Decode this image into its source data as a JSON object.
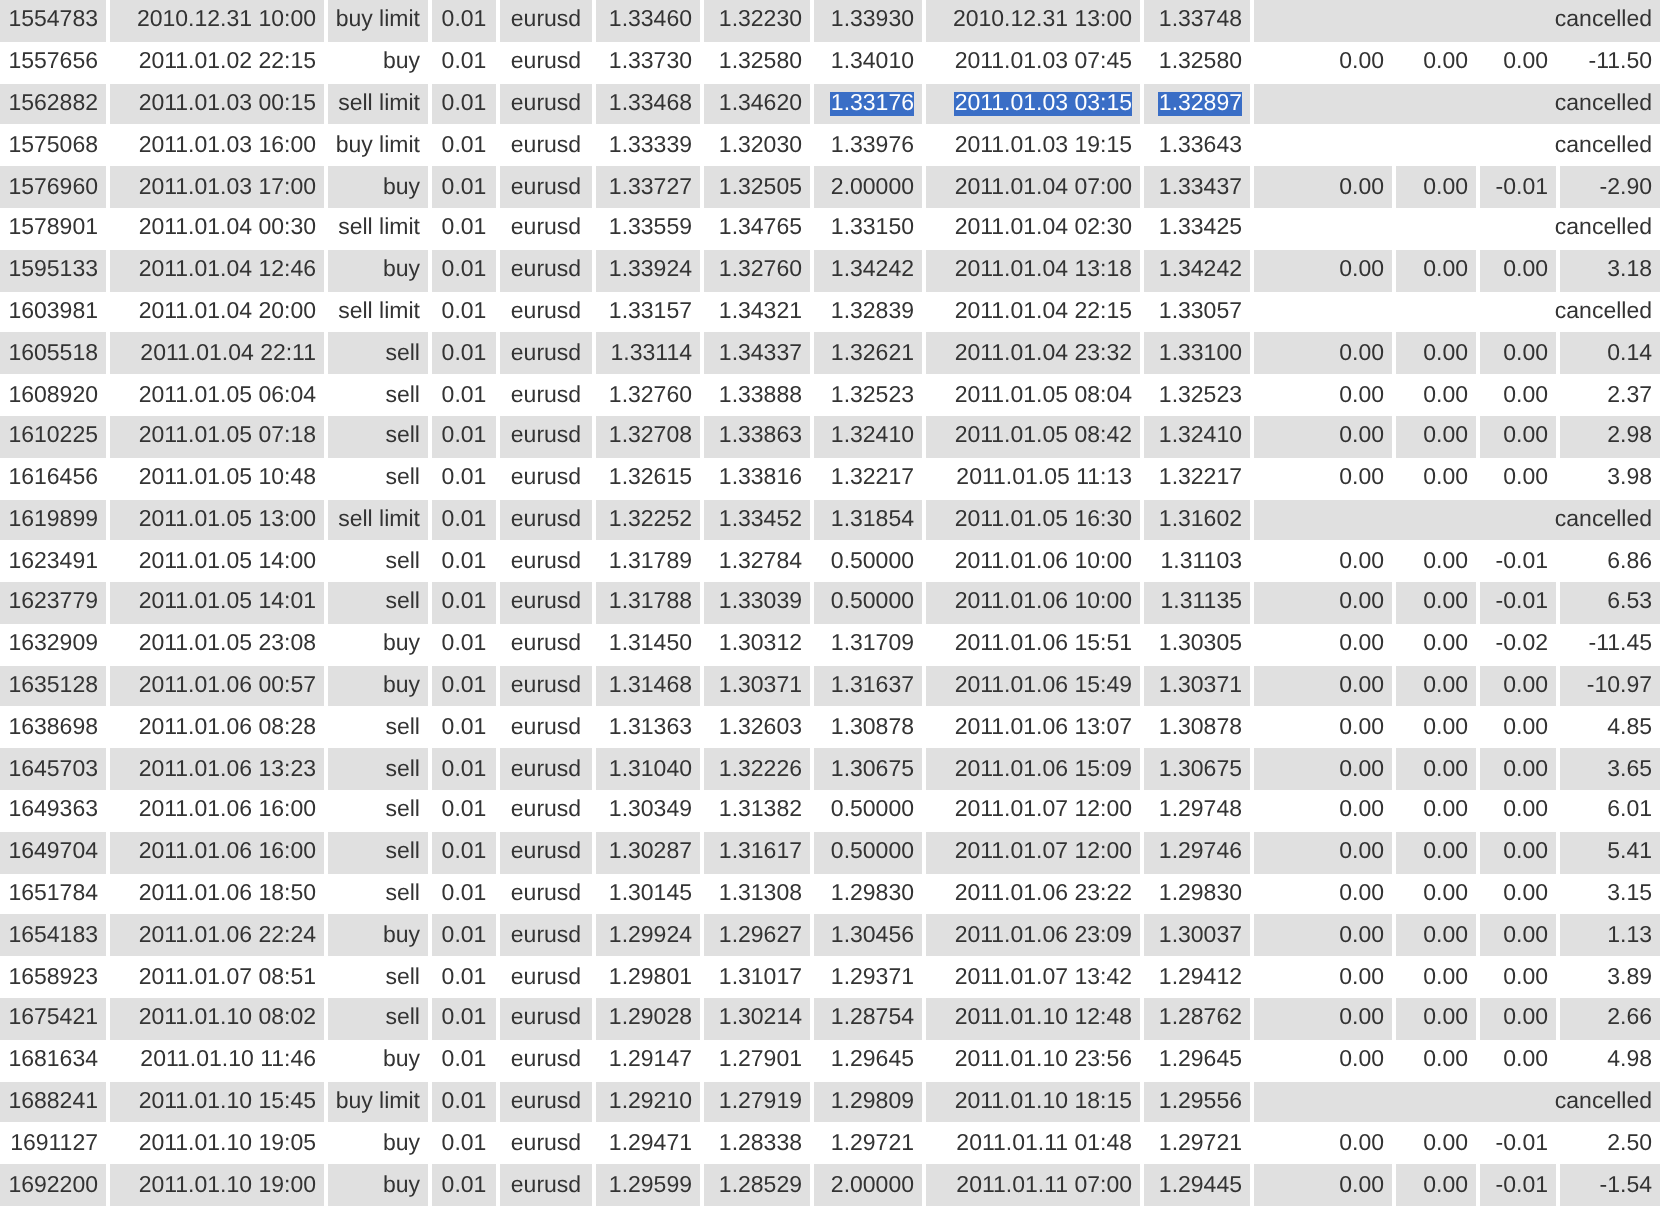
{
  "rows": [
    {
      "kind": "cancelled",
      "selected": false,
      "ticket": "1554783",
      "open_time": "2010.12.31 10:00",
      "type": "buy limit",
      "size": "0.01",
      "symbol": "eurusd",
      "open_price": "1.33460",
      "sl": "1.32230",
      "tp": "1.33930",
      "close_time": "2010.12.31 13:00",
      "close_price": "1.33748",
      "status": "cancelled"
    },
    {
      "kind": "closed",
      "selected": false,
      "ticket": "1557656",
      "open_time": "2011.01.02 22:15",
      "type": "buy",
      "size": "0.01",
      "symbol": "eurusd",
      "open_price": "1.33730",
      "sl": "1.32580",
      "tp": "1.34010",
      "close_time": "2011.01.03 07:45",
      "close_price": "1.32580",
      "commission": "0.00",
      "taxes": "0.00",
      "swap": "0.00",
      "profit": "-11.50"
    },
    {
      "kind": "cancelled",
      "selected": true,
      "ticket": "1562882",
      "open_time": "2011.01.03 00:15",
      "type": "sell limit",
      "size": "0.01",
      "symbol": "eurusd",
      "open_price": "1.33468",
      "sl": "1.34620",
      "tp": "1.33176",
      "close_time": "2011.01.03 03:15",
      "close_price": "1.32897",
      "status": "cancelled"
    },
    {
      "kind": "cancelled",
      "selected": false,
      "ticket": "1575068",
      "open_time": "2011.01.03 16:00",
      "type": "buy limit",
      "size": "0.01",
      "symbol": "eurusd",
      "open_price": "1.33339",
      "sl": "1.32030",
      "tp": "1.33976",
      "close_time": "2011.01.03 19:15",
      "close_price": "1.33643",
      "status": "cancelled"
    },
    {
      "kind": "closed",
      "selected": false,
      "ticket": "1576960",
      "open_time": "2011.01.03 17:00",
      "type": "buy",
      "size": "0.01",
      "symbol": "eurusd",
      "open_price": "1.33727",
      "sl": "1.32505",
      "tp": "2.00000",
      "close_time": "2011.01.04 07:00",
      "close_price": "1.33437",
      "commission": "0.00",
      "taxes": "0.00",
      "swap": "-0.01",
      "profit": "-2.90"
    },
    {
      "kind": "cancelled",
      "selected": false,
      "ticket": "1578901",
      "open_time": "2011.01.04 00:30",
      "type": "sell limit",
      "size": "0.01",
      "symbol": "eurusd",
      "open_price": "1.33559",
      "sl": "1.34765",
      "tp": "1.33150",
      "close_time": "2011.01.04 02:30",
      "close_price": "1.33425",
      "status": "cancelled"
    },
    {
      "kind": "closed",
      "selected": false,
      "ticket": "1595133",
      "open_time": "2011.01.04 12:46",
      "type": "buy",
      "size": "0.01",
      "symbol": "eurusd",
      "open_price": "1.33924",
      "sl": "1.32760",
      "tp": "1.34242",
      "close_time": "2011.01.04 13:18",
      "close_price": "1.34242",
      "commission": "0.00",
      "taxes": "0.00",
      "swap": "0.00",
      "profit": "3.18"
    },
    {
      "kind": "cancelled",
      "selected": false,
      "ticket": "1603981",
      "open_time": "2011.01.04 20:00",
      "type": "sell limit",
      "size": "0.01",
      "symbol": "eurusd",
      "open_price": "1.33157",
      "sl": "1.34321",
      "tp": "1.32839",
      "close_time": "2011.01.04 22:15",
      "close_price": "1.33057",
      "status": "cancelled"
    },
    {
      "kind": "closed",
      "selected": false,
      "ticket": "1605518",
      "open_time": "2011.01.04 22:11",
      "type": "sell",
      "size": "0.01",
      "symbol": "eurusd",
      "open_price": "1.33114",
      "sl": "1.34337",
      "tp": "1.32621",
      "close_time": "2011.01.04 23:32",
      "close_price": "1.33100",
      "commission": "0.00",
      "taxes": "0.00",
      "swap": "0.00",
      "profit": "0.14"
    },
    {
      "kind": "closed",
      "selected": false,
      "ticket": "1608920",
      "open_time": "2011.01.05 06:04",
      "type": "sell",
      "size": "0.01",
      "symbol": "eurusd",
      "open_price": "1.32760",
      "sl": "1.33888",
      "tp": "1.32523",
      "close_time": "2011.01.05 08:04",
      "close_price": "1.32523",
      "commission": "0.00",
      "taxes": "0.00",
      "swap": "0.00",
      "profit": "2.37"
    },
    {
      "kind": "closed",
      "selected": false,
      "ticket": "1610225",
      "open_time": "2011.01.05 07:18",
      "type": "sell",
      "size": "0.01",
      "symbol": "eurusd",
      "open_price": "1.32708",
      "sl": "1.33863",
      "tp": "1.32410",
      "close_time": "2011.01.05 08:42",
      "close_price": "1.32410",
      "commission": "0.00",
      "taxes": "0.00",
      "swap": "0.00",
      "profit": "2.98"
    },
    {
      "kind": "closed",
      "selected": false,
      "ticket": "1616456",
      "open_time": "2011.01.05 10:48",
      "type": "sell",
      "size": "0.01",
      "symbol": "eurusd",
      "open_price": "1.32615",
      "sl": "1.33816",
      "tp": "1.32217",
      "close_time": "2011.01.05 11:13",
      "close_price": "1.32217",
      "commission": "0.00",
      "taxes": "0.00",
      "swap": "0.00",
      "profit": "3.98"
    },
    {
      "kind": "cancelled",
      "selected": false,
      "ticket": "1619899",
      "open_time": "2011.01.05 13:00",
      "type": "sell limit",
      "size": "0.01",
      "symbol": "eurusd",
      "open_price": "1.32252",
      "sl": "1.33452",
      "tp": "1.31854",
      "close_time": "2011.01.05 16:30",
      "close_price": "1.31602",
      "status": "cancelled"
    },
    {
      "kind": "closed",
      "selected": false,
      "ticket": "1623491",
      "open_time": "2011.01.05 14:00",
      "type": "sell",
      "size": "0.01",
      "symbol": "eurusd",
      "open_price": "1.31789",
      "sl": "1.32784",
      "tp": "0.50000",
      "close_time": "2011.01.06 10:00",
      "close_price": "1.31103",
      "commission": "0.00",
      "taxes": "0.00",
      "swap": "-0.01",
      "profit": "6.86"
    },
    {
      "kind": "closed",
      "selected": false,
      "ticket": "1623779",
      "open_time": "2011.01.05 14:01",
      "type": "sell",
      "size": "0.01",
      "symbol": "eurusd",
      "open_price": "1.31788",
      "sl": "1.33039",
      "tp": "0.50000",
      "close_time": "2011.01.06 10:00",
      "close_price": "1.31135",
      "commission": "0.00",
      "taxes": "0.00",
      "swap": "-0.01",
      "profit": "6.53"
    },
    {
      "kind": "closed",
      "selected": false,
      "ticket": "1632909",
      "open_time": "2011.01.05 23:08",
      "type": "buy",
      "size": "0.01",
      "symbol": "eurusd",
      "open_price": "1.31450",
      "sl": "1.30312",
      "tp": "1.31709",
      "close_time": "2011.01.06 15:51",
      "close_price": "1.30305",
      "commission": "0.00",
      "taxes": "0.00",
      "swap": "-0.02",
      "profit": "-11.45"
    },
    {
      "kind": "closed",
      "selected": false,
      "ticket": "1635128",
      "open_time": "2011.01.06 00:57",
      "type": "buy",
      "size": "0.01",
      "symbol": "eurusd",
      "open_price": "1.31468",
      "sl": "1.30371",
      "tp": "1.31637",
      "close_time": "2011.01.06 15:49",
      "close_price": "1.30371",
      "commission": "0.00",
      "taxes": "0.00",
      "swap": "0.00",
      "profit": "-10.97"
    },
    {
      "kind": "closed",
      "selected": false,
      "ticket": "1638698",
      "open_time": "2011.01.06 08:28",
      "type": "sell",
      "size": "0.01",
      "symbol": "eurusd",
      "open_price": "1.31363",
      "sl": "1.32603",
      "tp": "1.30878",
      "close_time": "2011.01.06 13:07",
      "close_price": "1.30878",
      "commission": "0.00",
      "taxes": "0.00",
      "swap": "0.00",
      "profit": "4.85"
    },
    {
      "kind": "closed",
      "selected": false,
      "ticket": "1645703",
      "open_time": "2011.01.06 13:23",
      "type": "sell",
      "size": "0.01",
      "symbol": "eurusd",
      "open_price": "1.31040",
      "sl": "1.32226",
      "tp": "1.30675",
      "close_time": "2011.01.06 15:09",
      "close_price": "1.30675",
      "commission": "0.00",
      "taxes": "0.00",
      "swap": "0.00",
      "profit": "3.65"
    },
    {
      "kind": "closed",
      "selected": false,
      "ticket": "1649363",
      "open_time": "2011.01.06 16:00",
      "type": "sell",
      "size": "0.01",
      "symbol": "eurusd",
      "open_price": "1.30349",
      "sl": "1.31382",
      "tp": "0.50000",
      "close_time": "2011.01.07 12:00",
      "close_price": "1.29748",
      "commission": "0.00",
      "taxes": "0.00",
      "swap": "0.00",
      "profit": "6.01"
    },
    {
      "kind": "closed",
      "selected": false,
      "ticket": "1649704",
      "open_time": "2011.01.06 16:00",
      "type": "sell",
      "size": "0.01",
      "symbol": "eurusd",
      "open_price": "1.30287",
      "sl": "1.31617",
      "tp": "0.50000",
      "close_time": "2011.01.07 12:00",
      "close_price": "1.29746",
      "commission": "0.00",
      "taxes": "0.00",
      "swap": "0.00",
      "profit": "5.41"
    },
    {
      "kind": "closed",
      "selected": false,
      "ticket": "1651784",
      "open_time": "2011.01.06 18:50",
      "type": "sell",
      "size": "0.01",
      "symbol": "eurusd",
      "open_price": "1.30145",
      "sl": "1.31308",
      "tp": "1.29830",
      "close_time": "2011.01.06 23:22",
      "close_price": "1.29830",
      "commission": "0.00",
      "taxes": "0.00",
      "swap": "0.00",
      "profit": "3.15"
    },
    {
      "kind": "closed",
      "selected": false,
      "ticket": "1654183",
      "open_time": "2011.01.06 22:24",
      "type": "buy",
      "size": "0.01",
      "symbol": "eurusd",
      "open_price": "1.29924",
      "sl": "1.29627",
      "tp": "1.30456",
      "close_time": "2011.01.06 23:09",
      "close_price": "1.30037",
      "commission": "0.00",
      "taxes": "0.00",
      "swap": "0.00",
      "profit": "1.13"
    },
    {
      "kind": "closed",
      "selected": false,
      "ticket": "1658923",
      "open_time": "2011.01.07 08:51",
      "type": "sell",
      "size": "0.01",
      "symbol": "eurusd",
      "open_price": "1.29801",
      "sl": "1.31017",
      "tp": "1.29371",
      "close_time": "2011.01.07 13:42",
      "close_price": "1.29412",
      "commission": "0.00",
      "taxes": "0.00",
      "swap": "0.00",
      "profit": "3.89"
    },
    {
      "kind": "closed",
      "selected": false,
      "ticket": "1675421",
      "open_time": "2011.01.10 08:02",
      "type": "sell",
      "size": "0.01",
      "symbol": "eurusd",
      "open_price": "1.29028",
      "sl": "1.30214",
      "tp": "1.28754",
      "close_time": "2011.01.10 12:48",
      "close_price": "1.28762",
      "commission": "0.00",
      "taxes": "0.00",
      "swap": "0.00",
      "profit": "2.66"
    },
    {
      "kind": "closed",
      "selected": false,
      "ticket": "1681634",
      "open_time": "2011.01.10 11:46",
      "type": "buy",
      "size": "0.01",
      "symbol": "eurusd",
      "open_price": "1.29147",
      "sl": "1.27901",
      "tp": "1.29645",
      "close_time": "2011.01.10 23:56",
      "close_price": "1.29645",
      "commission": "0.00",
      "taxes": "0.00",
      "swap": "0.00",
      "profit": "4.98"
    },
    {
      "kind": "cancelled",
      "selected": false,
      "ticket": "1688241",
      "open_time": "2011.01.10 15:45",
      "type": "buy limit",
      "size": "0.01",
      "symbol": "eurusd",
      "open_price": "1.29210",
      "sl": "1.27919",
      "tp": "1.29809",
      "close_time": "2011.01.10 18:15",
      "close_price": "1.29556",
      "status": "cancelled"
    },
    {
      "kind": "closed",
      "selected": false,
      "ticket": "1691127",
      "open_time": "2011.01.10 19:05",
      "type": "buy",
      "size": "0.01",
      "symbol": "eurusd",
      "open_price": "1.29471",
      "sl": "1.28338",
      "tp": "1.29721",
      "close_time": "2011.01.11 01:48",
      "close_price": "1.29721",
      "commission": "0.00",
      "taxes": "0.00",
      "swap": "-0.01",
      "profit": "2.50"
    },
    {
      "kind": "closed",
      "selected": false,
      "ticket": "1692200",
      "open_time": "2011.01.10 19:00",
      "type": "buy",
      "size": "0.01",
      "symbol": "eurusd",
      "open_price": "1.29599",
      "sl": "1.28529",
      "tp": "2.00000",
      "close_time": "2011.01.11 07:00",
      "close_price": "1.29445",
      "commission": "0.00",
      "taxes": "0.00",
      "swap": "-0.01",
      "profit": "-1.54"
    }
  ]
}
